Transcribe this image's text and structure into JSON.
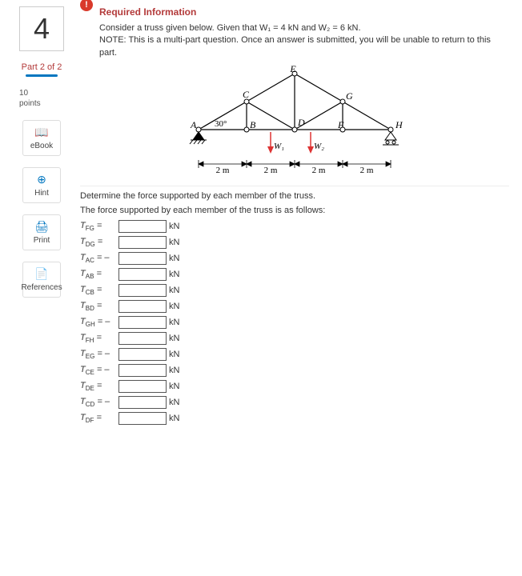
{
  "left": {
    "qnum": "4",
    "part": "Part 2 of 2",
    "points_num": "10",
    "points_label": "points",
    "tools": {
      "ebook": {
        "icon": "📖",
        "label": "eBook"
      },
      "hint": {
        "icon": "⊕",
        "label": "Hint"
      },
      "print": {
        "icon": "🖨",
        "label": "Print"
      },
      "references": {
        "icon": "📄",
        "label": "References"
      }
    }
  },
  "info": {
    "mark": "!",
    "title": "Required Information",
    "line1": "Consider a truss given below. Given that W₁ = 4 kN and W₂ = 6 kN.",
    "line2": "NOTE: This is a multi-part question. Once an answer is submitted, you will be unable to return to this part."
  },
  "figure": {
    "labels": {
      "A": "A",
      "B": "B",
      "C": "C",
      "D": "D",
      "E": "E",
      "F": "F",
      "G": "G",
      "H": "H",
      "angle": "30°",
      "W1": "W₁",
      "W2": "W₂",
      "d1": "2 m",
      "d2": "2 m",
      "d3": "2 m",
      "d4": "2 m"
    }
  },
  "question": {
    "prompt": "Determine the force supported by each member of the truss.",
    "lead": "The force supported by each member of the truss is as follows:",
    "unit": "kN",
    "rows": [
      {
        "sub": "FG",
        "sign": "="
      },
      {
        "sub": "DG",
        "sign": "="
      },
      {
        "sub": "AC",
        "sign": "= –"
      },
      {
        "sub": "AB",
        "sign": "="
      },
      {
        "sub": "CB",
        "sign": "="
      },
      {
        "sub": "BD",
        "sign": "="
      },
      {
        "sub": "GH",
        "sign": "= –"
      },
      {
        "sub": "FH",
        "sign": "="
      },
      {
        "sub": "EG",
        "sign": "= –"
      },
      {
        "sub": "CE",
        "sign": "= –"
      },
      {
        "sub": "DE",
        "sign": "="
      },
      {
        "sub": "CD",
        "sign": "= –"
      },
      {
        "sub": "DF",
        "sign": "="
      }
    ]
  }
}
